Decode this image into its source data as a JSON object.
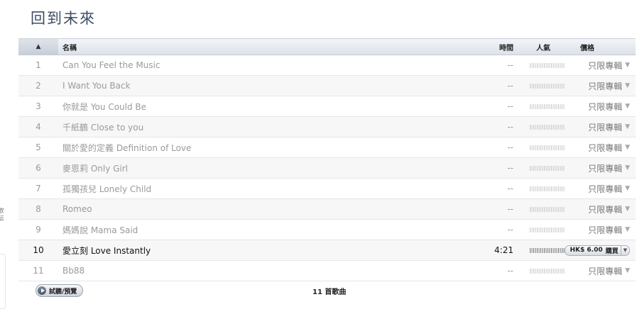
{
  "album": {
    "title": "回到未來"
  },
  "sidebar_edge": {
    "text": "收\n伝"
  },
  "table": {
    "headers": {
      "sort_indicator": "▲",
      "name": "名稱",
      "time": "時間",
      "popularity": "人氣",
      "price": "價格"
    },
    "tracks": [
      {
        "num": "1",
        "name": "Can You Feel the Music",
        "time": "--",
        "price": "只限專輯"
      },
      {
        "num": "2",
        "name": "I Want You Back",
        "time": "--",
        "price": "只限專輯"
      },
      {
        "num": "3",
        "name": "你就是 You Could Be",
        "time": "--",
        "price": "只限專輯"
      },
      {
        "num": "4",
        "name": "千紙鶴 Close to you",
        "time": "--",
        "price": "只限專輯"
      },
      {
        "num": "5",
        "name": "關於愛的定義 Definition of Love",
        "time": "--",
        "price": "只限專輯"
      },
      {
        "num": "6",
        "name": "麥恩莉 Only Girl",
        "time": "--",
        "price": "只限專輯"
      },
      {
        "num": "7",
        "name": "孤獨孩兒 Lonely Child",
        "time": "--",
        "price": "只限專輯"
      },
      {
        "num": "8",
        "name": "Romeo",
        "time": "--",
        "price": "只限專輯"
      },
      {
        "num": "9",
        "name": "媽媽說 Mama Said",
        "time": "--",
        "price": "只限專輯"
      },
      {
        "num": "10",
        "name": "愛立刻 Love Instantly",
        "time": "4:21",
        "price": "HK$ 6.00",
        "buy_label": "購買"
      },
      {
        "num": "11",
        "name": "Bb88",
        "time": "--",
        "price": "只限專輯"
      }
    ]
  },
  "footer": {
    "preview_label": "試聽/預覽",
    "song_count": "11 首歌曲"
  },
  "colors": {
    "title": "#3d4d63",
    "disabled_text": "#9a9a9a",
    "header_bg": "#dde2e9"
  }
}
